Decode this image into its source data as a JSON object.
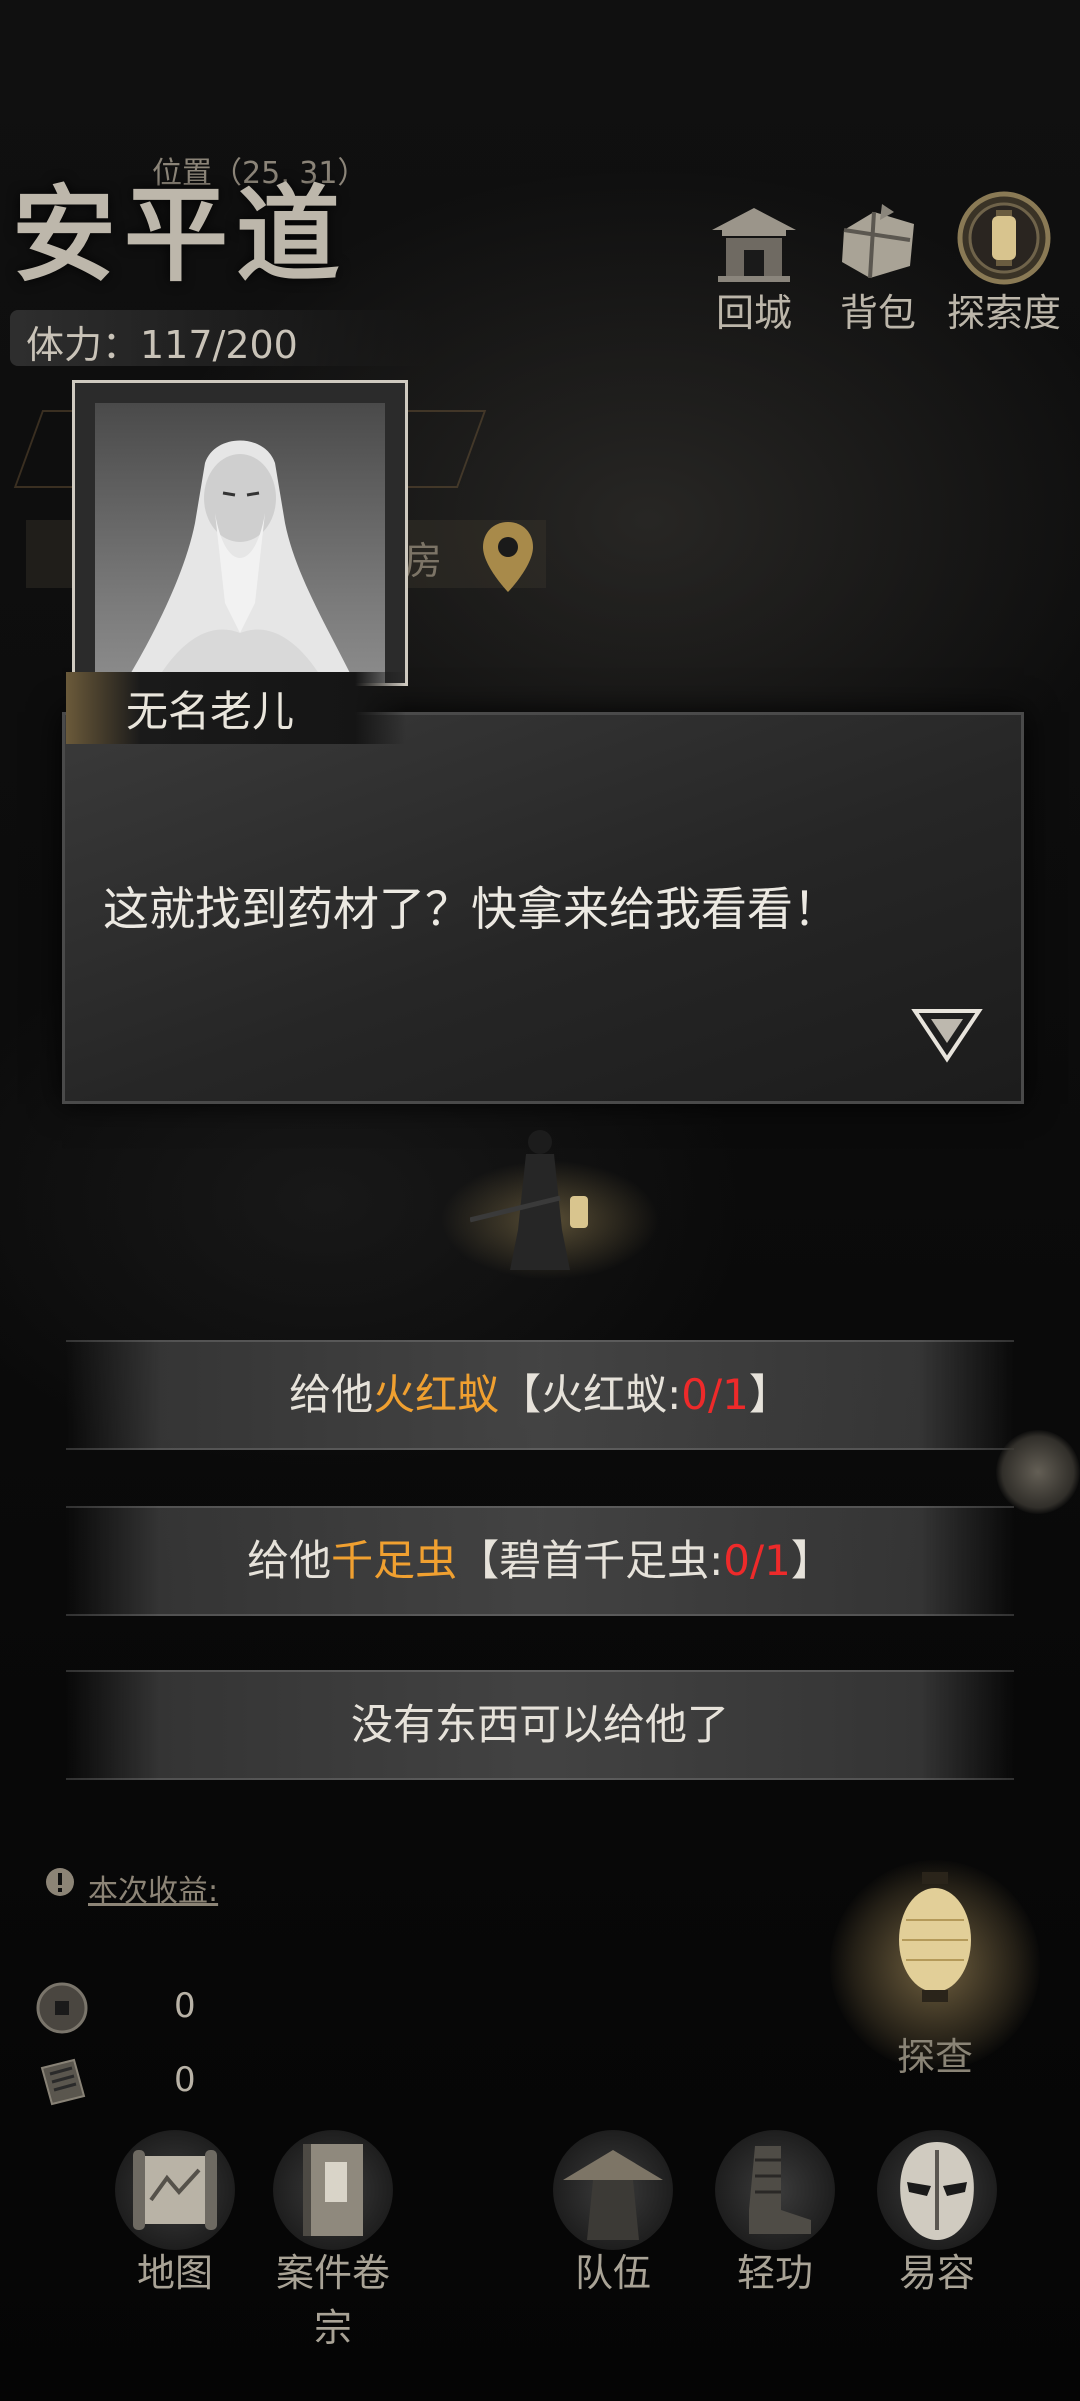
{
  "header": {
    "position_label": "位置（25, 31）",
    "place_name": "安平道",
    "stamina": "体力：117/200"
  },
  "top_buttons": [
    {
      "label": "回城",
      "icon": "city-gate-icon"
    },
    {
      "label": "背包",
      "icon": "bundle-bag-icon"
    },
    {
      "label": "探索度",
      "icon": "lantern-medallion-icon"
    }
  ],
  "background_ui": {
    "partial_room_text": "房"
  },
  "speaker": {
    "name": "无名老儿"
  },
  "dialog": {
    "text": "这就找到药材了？快拿来给我看看！"
  },
  "choices": [
    {
      "prefix": "给他",
      "item": "火红蚁",
      "bracket_open": "【",
      "need_name": "火红蚁:",
      "count": "0/1",
      "bracket_close": "】"
    },
    {
      "prefix": "给他",
      "item": "千足虫",
      "bracket_open": "【",
      "need_name": "碧首千足虫:",
      "count": "0/1",
      "bracket_close": "】"
    },
    {
      "text": "没有东西可以给他了"
    }
  ],
  "earnings": {
    "title": "本次收益:",
    "coins": "0",
    "scrolls": "0"
  },
  "investigate": {
    "label": "探查"
  },
  "bottom_nav": [
    {
      "label": "地图",
      "icon": "map-scroll-icon"
    },
    {
      "label": "案件卷宗",
      "icon": "case-file-icon"
    },
    {
      "label": "队伍",
      "icon": "team-hat-icon"
    },
    {
      "label": "轻功",
      "icon": "boots-icon"
    },
    {
      "label": "易容",
      "icon": "mask-icon"
    }
  ],
  "colors": {
    "item_highlight": "#f0a030",
    "count_missing": "#ee2a2a"
  }
}
